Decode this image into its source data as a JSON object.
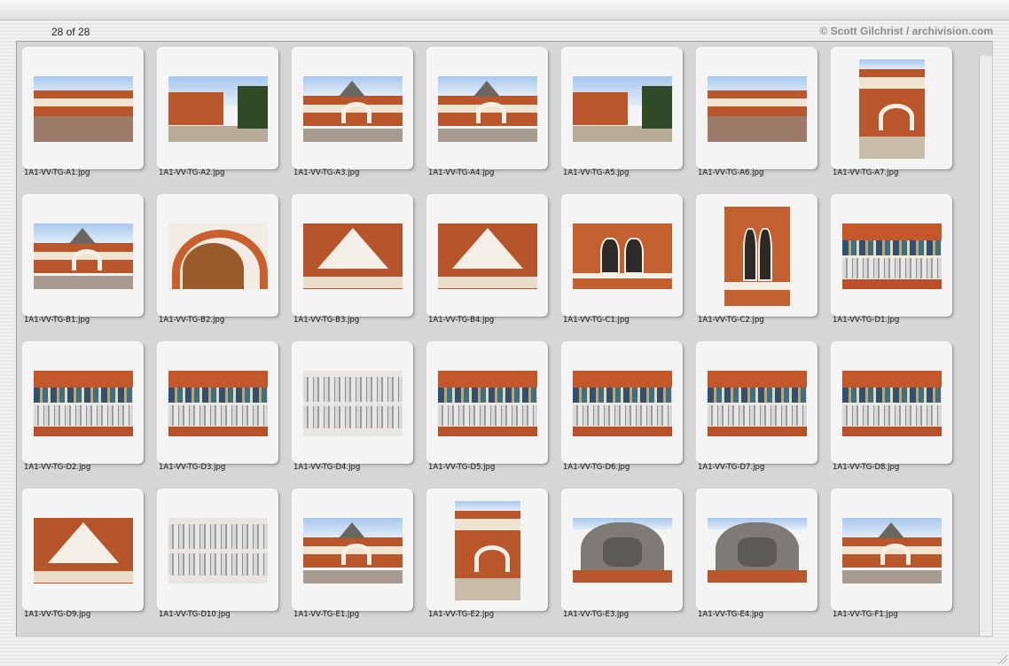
{
  "header": {
    "counter": "28 of 28",
    "credit": "© Scott Gilchrist / archivision.com"
  },
  "thumbnails": [
    {
      "filename": "1A1-VV-TG-A1.jpg",
      "icon": "courtyard-photo",
      "orientation": "landscape"
    },
    {
      "filename": "1A1-VV-TG-A2.jpg",
      "icon": "street-photo",
      "orientation": "landscape"
    },
    {
      "filename": "1A1-VV-TG-A3.jpg",
      "icon": "facade-photo",
      "orientation": "landscape"
    },
    {
      "filename": "1A1-VV-TG-A4.jpg",
      "icon": "facade-photo",
      "orientation": "landscape"
    },
    {
      "filename": "1A1-VV-TG-A5.jpg",
      "icon": "street-photo",
      "orientation": "landscape"
    },
    {
      "filename": "1A1-VV-TG-A6.jpg",
      "icon": "courtyard-photo",
      "orientation": "landscape"
    },
    {
      "filename": "1A1-VV-TG-A7.jpg",
      "icon": "tower-photo",
      "orientation": "portrait"
    },
    {
      "filename": "1A1-VV-TG-B1.jpg",
      "icon": "facade-photo",
      "orientation": "landscape"
    },
    {
      "filename": "1A1-VV-TG-B2.jpg",
      "icon": "arch-photo",
      "orientation": "landscape"
    },
    {
      "filename": "1A1-VV-TG-B3.jpg",
      "icon": "gable-photo",
      "orientation": "landscape"
    },
    {
      "filename": "1A1-VV-TG-B4.jpg",
      "icon": "gable-photo",
      "orientation": "landscape"
    },
    {
      "filename": "1A1-VV-TG-C1.jpg",
      "icon": "window-photo",
      "orientation": "landscape"
    },
    {
      "filename": "1A1-VV-TG-C2.jpg",
      "icon": "window-photo",
      "orientation": "portrait"
    },
    {
      "filename": "1A1-VV-TG-D1.jpg",
      "icon": "frieze-photo",
      "orientation": "landscape"
    },
    {
      "filename": "1A1-VV-TG-D2.jpg",
      "icon": "frieze-photo",
      "orientation": "landscape"
    },
    {
      "filename": "1A1-VV-TG-D3.jpg",
      "icon": "frieze-photo",
      "orientation": "landscape"
    },
    {
      "filename": "1A1-VV-TG-D4.jpg",
      "icon": "inscription-photo",
      "orientation": "landscape"
    },
    {
      "filename": "1A1-VV-TG-D5.jpg",
      "icon": "frieze-photo",
      "orientation": "landscape"
    },
    {
      "filename": "1A1-VV-TG-D6.jpg",
      "icon": "frieze-photo",
      "orientation": "landscape"
    },
    {
      "filename": "1A1-VV-TG-D7.jpg",
      "icon": "frieze-photo",
      "orientation": "landscape"
    },
    {
      "filename": "1A1-VV-TG-D8.jpg",
      "icon": "frieze-photo",
      "orientation": "landscape"
    },
    {
      "filename": "1A1-VV-TG-D9.jpg",
      "icon": "gable-photo",
      "orientation": "landscape"
    },
    {
      "filename": "1A1-VV-TG-D10.jpg",
      "icon": "inscription-photo",
      "orientation": "landscape"
    },
    {
      "filename": "1A1-VV-TG-E1.jpg",
      "icon": "facade-photo",
      "orientation": "landscape"
    },
    {
      "filename": "1A1-VV-TG-E2.jpg",
      "icon": "tower-photo",
      "orientation": "portrait"
    },
    {
      "filename": "1A1-VV-TG-E3.jpg",
      "icon": "relief-photo",
      "orientation": "landscape"
    },
    {
      "filename": "1A1-VV-TG-E4.jpg",
      "icon": "relief-photo",
      "orientation": "landscape"
    },
    {
      "filename": "1A1-VV-TG-F1.jpg",
      "icon": "facade-photo",
      "orientation": "landscape"
    }
  ]
}
